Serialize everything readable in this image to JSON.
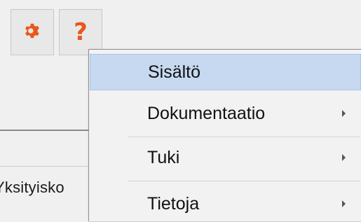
{
  "toolbar": {
    "settings_icon": "gear-icon",
    "help_icon": "question-mark-icon",
    "help_glyph": "?",
    "accent_color": "#e8571c"
  },
  "background": {
    "partial_label": "Yksityisko"
  },
  "menu": {
    "items": [
      {
        "label": "Sisältö",
        "highlighted": true,
        "has_submenu": false
      },
      {
        "label": "Dokumentaatio",
        "highlighted": false,
        "has_submenu": true
      },
      {
        "label": "Tuki",
        "highlighted": false,
        "has_submenu": true
      },
      {
        "label": "Tietoja",
        "highlighted": false,
        "has_submenu": true
      }
    ]
  }
}
